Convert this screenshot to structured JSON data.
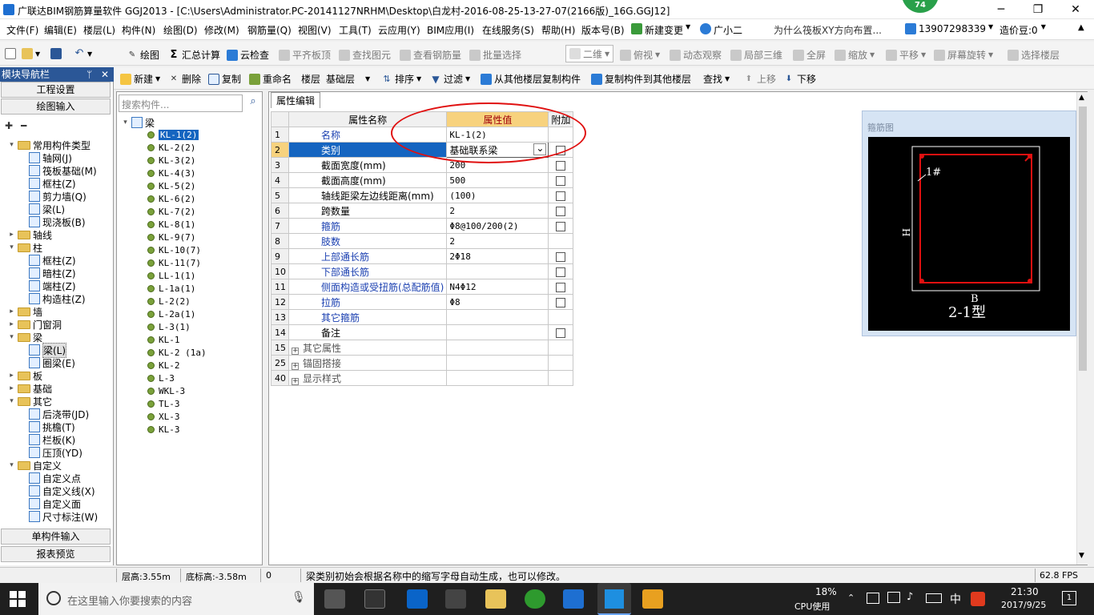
{
  "window": {
    "title": "广联达BIM钢筋算量软件 GGJ2013 - [C:\\Users\\Administrator.PC-20141127NRHM\\Desktop\\白龙村-2016-08-25-13-27-07(2166版)_16G.GGJ12]",
    "badge": "74",
    "min": "─",
    "max": "❐",
    "close": "✕"
  },
  "menu": [
    "文件(F)",
    "编辑(E)",
    "楼层(L)",
    "构件(N)",
    "绘图(D)",
    "修改(M)",
    "钢筋量(Q)",
    "视图(V)",
    "工具(T)",
    "云应用(Y)",
    "BIM应用(I)",
    "在线服务(S)",
    "帮助(H)",
    "版本号(B)",
    "新建变更",
    "广小二"
  ],
  "menu_right": {
    "question": "为什么筏板XY方向布置...",
    "phone": "13907298339",
    "coins": "造价豆:0"
  },
  "toolbar1": {
    "draw": "绘图",
    "calc": "汇总计算",
    "cloud": "云检查",
    "flat": "平齐板顶",
    "find": "查找图元",
    "rebar": "查看钢筋量",
    "batch": "批量选择",
    "view2d": "二维",
    "top": "俯视",
    "dynamic": "动态观察",
    "local3d": "局部三维",
    "fullscreen": "全屏",
    "zoom": "缩放",
    "pan": "平移",
    "rotate": "屏幕旋转",
    "selfloor": "选择楼层"
  },
  "toolbar2": {
    "new": "新建",
    "delete": "删除",
    "copy": "复制",
    "rename": "重命名",
    "floor": "楼层",
    "floor_value": "基础层",
    "sort": "排序",
    "filter": "过滤",
    "copy_from": "从其他楼层复制构件",
    "copy_to": "复制构件到其他楼层",
    "find": "查找",
    "up": "上移",
    "down": "下移"
  },
  "nav": {
    "title": "模块导航栏",
    "pin": "ᛘ",
    "close": "✕",
    "project": "工程设置",
    "draw_input": "绘图输入",
    "single": "单构件输入",
    "report": "报表预览"
  },
  "tree": [
    {
      "t": "常用构件类型",
      "lvl": 0,
      "folder": true,
      "open": true
    },
    {
      "t": "轴网(J)",
      "lvl": 1
    },
    {
      "t": "筏板基础(M)",
      "lvl": 1
    },
    {
      "t": "框柱(Z)",
      "lvl": 1
    },
    {
      "t": "剪力墙(Q)",
      "lvl": 1
    },
    {
      "t": "梁(L)",
      "lvl": 1
    },
    {
      "t": "现浇板(B)",
      "lvl": 1
    },
    {
      "t": "轴线",
      "lvl": 0,
      "folder": true
    },
    {
      "t": "柱",
      "lvl": 0,
      "folder": true,
      "open": true
    },
    {
      "t": "框柱(Z)",
      "lvl": 1
    },
    {
      "t": "暗柱(Z)",
      "lvl": 1
    },
    {
      "t": "端柱(Z)",
      "lvl": 1
    },
    {
      "t": "构造柱(Z)",
      "lvl": 1
    },
    {
      "t": "墙",
      "lvl": 0,
      "folder": true
    },
    {
      "t": "门窗洞",
      "lvl": 0,
      "folder": true
    },
    {
      "t": "梁",
      "lvl": 0,
      "folder": true,
      "open": true
    },
    {
      "t": "梁(L)",
      "lvl": 1,
      "sel": true
    },
    {
      "t": "圈梁(E)",
      "lvl": 1
    },
    {
      "t": "板",
      "lvl": 0,
      "folder": true
    },
    {
      "t": "基础",
      "lvl": 0,
      "folder": true
    },
    {
      "t": "其它",
      "lvl": 0,
      "folder": true,
      "open": true
    },
    {
      "t": "后浇带(JD)",
      "lvl": 1
    },
    {
      "t": "挑檐(T)",
      "lvl": 1
    },
    {
      "t": "栏板(K)",
      "lvl": 1
    },
    {
      "t": "压顶(YD)",
      "lvl": 1
    },
    {
      "t": "自定义",
      "lvl": 0,
      "folder": true,
      "open": true
    },
    {
      "t": "自定义点",
      "lvl": 1
    },
    {
      "t": "自定义线(X)",
      "lvl": 1
    },
    {
      "t": "自定义面",
      "lvl": 1
    },
    {
      "t": "尺寸标注(W)",
      "lvl": 1
    }
  ],
  "components": {
    "search_placeholder": "搜索构件...",
    "root": "梁",
    "items": [
      "KL-1(2)",
      "KL-2(2)",
      "KL-3(2)",
      "KL-4(3)",
      "KL-5(2)",
      "KL-6(2)",
      "KL-7(2)",
      "KL-8(1)",
      "KL-9(7)",
      "KL-10(7)",
      "KL-11(7)",
      "LL-1(1)",
      "L-1a(1)",
      "L-2(2)",
      "L-2a(1)",
      "L-3(1)",
      "KL-1",
      "KL-2 (1a)",
      "KL-2",
      "L-3",
      "WKL-3",
      "TL-3",
      "XL-3",
      "KL-3"
    ]
  },
  "props": {
    "tab": "属性编辑",
    "col_name": "属性名称",
    "col_value": "属性值",
    "col_extra": "附加",
    "rows": [
      {
        "n": "1",
        "name": "名称",
        "value": "KL-1(2)",
        "chk": false,
        "cls": "nm"
      },
      {
        "n": "2",
        "name": "类别",
        "value": "基础联系梁",
        "chk": true,
        "cls": "nm",
        "sel": true
      },
      {
        "n": "3",
        "name": "截面宽度(mm)",
        "value": "200",
        "chk": true,
        "cls": "nm bk"
      },
      {
        "n": "4",
        "name": "截面高度(mm)",
        "value": "500",
        "chk": true,
        "cls": "nm bk"
      },
      {
        "n": "5",
        "name": "轴线距梁左边线距离(mm)",
        "value": "(100)",
        "chk": true,
        "cls": "nm bk"
      },
      {
        "n": "6",
        "name": "跨数量",
        "value": "2",
        "chk": true,
        "cls": "nm bk"
      },
      {
        "n": "7",
        "name": "箍筋",
        "value": "Φ8@100/200(2)",
        "chk": true,
        "cls": "nm"
      },
      {
        "n": "8",
        "name": "肢数",
        "value": "2",
        "chk": false,
        "cls": "nm"
      },
      {
        "n": "9",
        "name": "上部通长筋",
        "value": "2Φ18",
        "chk": true,
        "cls": "nm"
      },
      {
        "n": "10",
        "name": "下部通长筋",
        "value": "",
        "chk": true,
        "cls": "nm"
      },
      {
        "n": "11",
        "name": "侧面构造或受扭筋(总配筋值)",
        "value": "N4Φ12",
        "chk": true,
        "cls": "nm"
      },
      {
        "n": "12",
        "name": "拉筋",
        "value": "Φ8",
        "chk": true,
        "cls": "nm"
      },
      {
        "n": "13",
        "name": "其它箍筋",
        "value": "",
        "chk": false,
        "cls": "nm"
      },
      {
        "n": "14",
        "name": "备注",
        "value": "",
        "chk": true,
        "cls": "nm bk"
      },
      {
        "n": "15",
        "name": "其它属性",
        "value": "",
        "chk": false,
        "cls": "nm gy",
        "plus": true
      },
      {
        "n": "25",
        "name": "锚固搭接",
        "value": "",
        "chk": false,
        "cls": "nm gy",
        "plus": true
      },
      {
        "n": "40",
        "name": "显示样式",
        "value": "",
        "chk": false,
        "cls": "nm gy",
        "plus": true
      }
    ]
  },
  "stirrup": {
    "caption": "箍筋图",
    "label_1": "1#",
    "label_h": "H",
    "label_b": "B",
    "type": "2-1型"
  },
  "status": {
    "floor_h": "层高:3.55m",
    "base_h": "底标高:-3.58m",
    "num": "0",
    "hint": "梁类别初始会根据名称中的缩写字母自动生成，也可以修改。",
    "fps": "62.8 FPS"
  },
  "taskbar": {
    "search": "在这里输入你要搜索的内容",
    "cpu_pct": "18%",
    "cpu_label": "CPU使用",
    "ime": "中",
    "time": "21:30",
    "date": "2017/9/25",
    "notify": "1"
  },
  "colors": {
    "accent": "#2b5797",
    "highlight_header": "#f7d27e",
    "selected_row": "#1565c0",
    "annotation": "#e01010"
  }
}
